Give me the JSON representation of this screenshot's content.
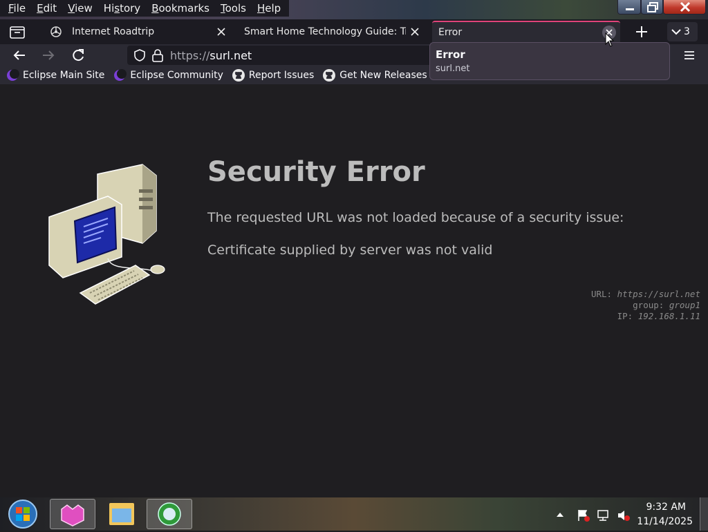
{
  "menu": {
    "items": [
      {
        "label": "File",
        "accel": "F",
        "rest": "ile"
      },
      {
        "label": "Edit",
        "accel": "E",
        "rest": "dit"
      },
      {
        "label": "View",
        "accel": "V",
        "rest": "iew"
      },
      {
        "label": "History",
        "accel": "",
        "pre": "Hi",
        "mid": "s",
        "post": "tory"
      },
      {
        "label": "Bookmarks",
        "accel": "B",
        "rest": "ookmarks"
      },
      {
        "label": "Tools",
        "accel": "T",
        "rest": "ools"
      },
      {
        "label": "Help",
        "accel": "H",
        "rest": "elp"
      }
    ]
  },
  "tabs": [
    {
      "title": "Internet Roadtrip",
      "active": false
    },
    {
      "title": "Smart Home Technology Guide: Trai",
      "active": false
    },
    {
      "title": "Error",
      "active": true
    }
  ],
  "tab_count": "3",
  "nav": {
    "url_scheme": "https://",
    "url_host": "surl.net"
  },
  "bookmarks": [
    {
      "label": "Eclipse Main Site",
      "icon": "eclipse-icon"
    },
    {
      "label": "Eclipse Community",
      "icon": "eclipse-icon"
    },
    {
      "label": "Report Issues",
      "icon": "github-icon"
    },
    {
      "label": "Get New Releases",
      "icon": "github-icon"
    }
  ],
  "tooltip": {
    "title": "Error",
    "url": "surl.net"
  },
  "error": {
    "title": "Security Error",
    "message": "The requested URL was not loaded because of a security issue:",
    "detail": "Certificate supplied by server was not valid",
    "diag": {
      "url_label": "URL:",
      "url_value": "https://surl.net",
      "group_label": "group:",
      "group_value": "group1",
      "ip_label": "IP:",
      "ip_value": "192.168.1.11"
    }
  },
  "taskbar": {
    "time": "9:32 AM",
    "date": "11/14/2025"
  },
  "colors": {
    "accent_tab": "#e0437a",
    "content_bg": "#1f1e21",
    "toolbar_bg": "#2b2a33"
  }
}
